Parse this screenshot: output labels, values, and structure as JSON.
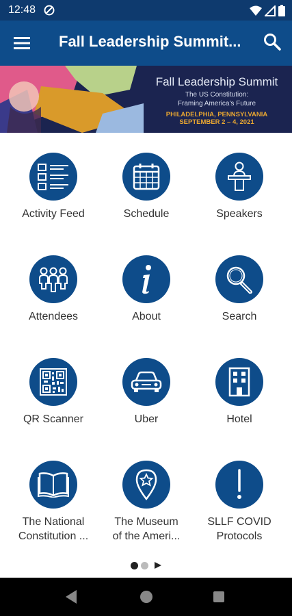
{
  "status_bar": {
    "time": "12:48"
  },
  "app_bar": {
    "title": "Fall Leadership Summit...",
    "menu_icon": "hamburger-menu-icon",
    "search_icon": "search-icon"
  },
  "banner": {
    "title": "Fall Leadership Summit",
    "subtitle_line1": "The US Constitution:",
    "subtitle_line2": "Framing America's Future",
    "location": "PHILADELPHIA, PENNSYLVANIA",
    "dates": "SEPTEMBER 2 – 4, 2021"
  },
  "tiles": [
    {
      "label": "Activity Feed",
      "icon": "list-icon"
    },
    {
      "label": "Schedule",
      "icon": "calendar-icon"
    },
    {
      "label": "Speakers",
      "icon": "speaker-podium-icon"
    },
    {
      "label": "Attendees",
      "icon": "people-icon"
    },
    {
      "label": "About",
      "icon": "info-icon"
    },
    {
      "label": "Search",
      "icon": "magnifier-icon"
    },
    {
      "label": "QR Scanner",
      "icon": "qr-code-icon"
    },
    {
      "label": "Uber",
      "icon": "car-icon"
    },
    {
      "label": "Hotel",
      "icon": "building-icon"
    },
    {
      "label": "The National",
      "label2": "Constitution ...",
      "icon": "book-icon"
    },
    {
      "label": "The Museum",
      "label2": "of the Ameri...",
      "icon": "map-pin-star-icon"
    },
    {
      "label": "SLLF COVID",
      "label2": "Protocols",
      "icon": "exclamation-icon"
    }
  ],
  "pager": {
    "active_page": 1,
    "page_count": 2
  },
  "colors": {
    "primary": "#0e4c8a",
    "status_bar": "#0e3a6e",
    "banner_bg": "#1b2450",
    "banner_accent": "#e8a631"
  }
}
